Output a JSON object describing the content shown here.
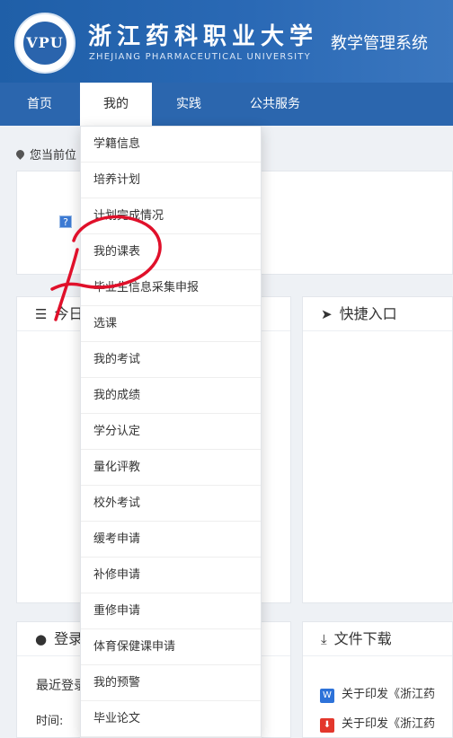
{
  "header": {
    "logo_mark": "VPU",
    "univ_name_cn": "浙江药科职业大学",
    "univ_name_en": "ZHEJIANG PHARMACEUTICAL UNIVERSITY",
    "system_title": "教学管理系统"
  },
  "nav": {
    "items": [
      {
        "label": "首页"
      },
      {
        "label": "我的"
      },
      {
        "label": "实践"
      },
      {
        "label": "公共服务"
      }
    ]
  },
  "breadcrumb": {
    "label": "您当前位"
  },
  "panels": {
    "today": {
      "title": "今日"
    },
    "quick": {
      "title": "快捷入口"
    },
    "login": {
      "title": "登录",
      "recent": "最近登录",
      "time_label": "时间:"
    },
    "files": {
      "title": "文件下载",
      "items": [
        {
          "type": "W",
          "text": "关于印发《浙江药"
        },
        {
          "type": "PDF",
          "text": "关于印发《浙江药"
        }
      ]
    }
  },
  "dropdown": {
    "items": [
      {
        "label": "学籍信息"
      },
      {
        "label": "培养计划"
      },
      {
        "label": "计划完成情况"
      },
      {
        "label": "我的课表"
      },
      {
        "label": "毕业生信息采集申报"
      },
      {
        "label": "选课"
      },
      {
        "label": "我的考试"
      },
      {
        "label": "我的成绩"
      },
      {
        "label": "学分认定"
      },
      {
        "label": "量化评教"
      },
      {
        "label": "校外考试"
      },
      {
        "label": "缓考申请"
      },
      {
        "label": "补修申请"
      },
      {
        "label": "重修申请"
      },
      {
        "label": "体育保健课申请"
      },
      {
        "label": "我的预警"
      },
      {
        "label": "毕业论文"
      }
    ]
  },
  "colors": {
    "header_blue": "#1f5fa8",
    "nav_blue": "#2b66ae",
    "annotation_red": "#e0102a"
  }
}
